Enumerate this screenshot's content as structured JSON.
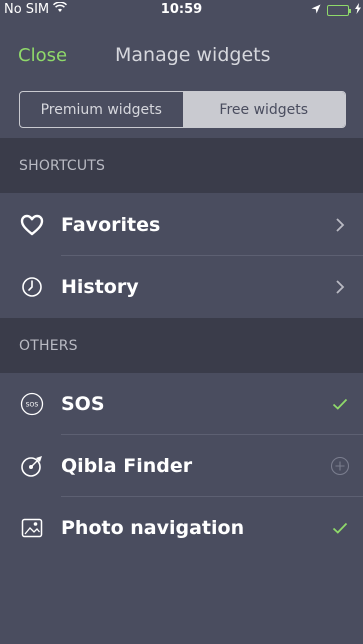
{
  "status_bar": {
    "carrier": "No SIM",
    "time": "10:59",
    "icons": [
      "wifi-icon",
      "location-arrow-icon",
      "battery-icon",
      "charging-icon"
    ]
  },
  "nav": {
    "close_label": "Close",
    "title": "Manage widgets"
  },
  "tabs": [
    {
      "label": "Premium widgets",
      "selected": false
    },
    {
      "label": "Free widgets",
      "selected": true
    }
  ],
  "sections": [
    {
      "header": "SHORTCUTS",
      "items": [
        {
          "label": "Favorites",
          "icon": "heart-icon",
          "accessory": "chevron-right-icon"
        },
        {
          "label": "History",
          "icon": "clock-icon",
          "accessory": "chevron-right-icon"
        }
      ]
    },
    {
      "header": "OTHERS",
      "items": [
        {
          "label": "SOS",
          "icon": "sos-icon",
          "badge_text": "SOS",
          "accessory": "checkmark-icon"
        },
        {
          "label": "Qibla Finder",
          "icon": "compass-icon",
          "accessory": "add-circle-icon"
        },
        {
          "label": "Photo navigation",
          "icon": "photo-navigation-icon",
          "accessory": "checkmark-icon"
        }
      ]
    }
  ],
  "colors": {
    "background": "#4a4d5f",
    "section_header_bg": "#3a3c4a",
    "accent_green": "#8fd96a",
    "muted_text": "#b9bac3",
    "segment_selected_bg": "#c9cad0"
  }
}
